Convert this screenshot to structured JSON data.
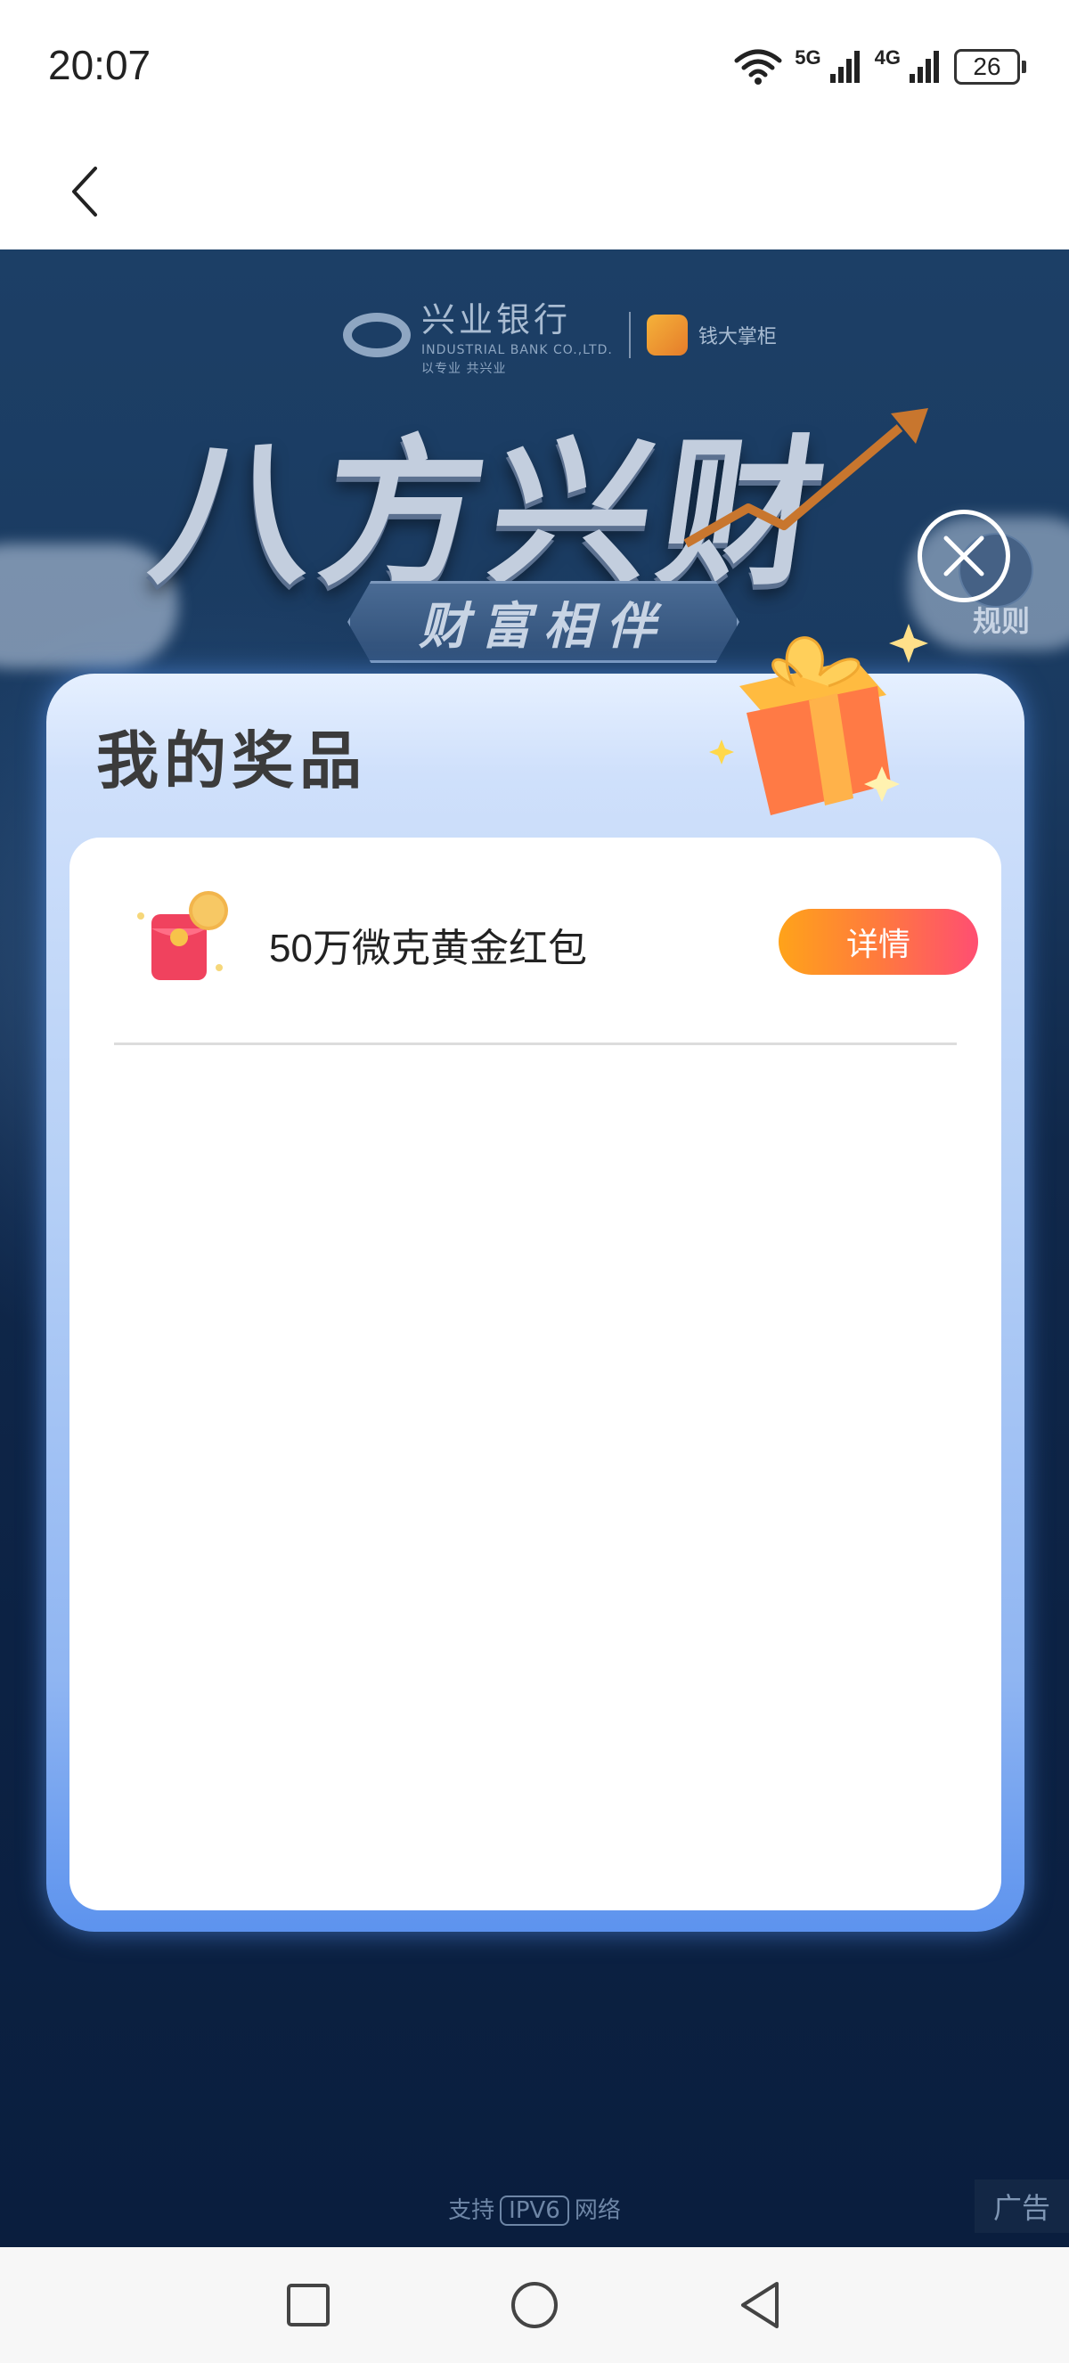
{
  "status_bar": {
    "time": "20:07",
    "network_1": "5G",
    "network_2": "4G",
    "battery": "26"
  },
  "banner": {
    "bank_name": "兴业银行",
    "bank_english": "INDUSTRIAL BANK CO.,LTD.",
    "bank_slogan": "以专业 共兴业",
    "partner_name": "钱大掌柜",
    "title": "八方兴财",
    "subtitle": "财富相伴",
    "rules_label": "规则"
  },
  "modal": {
    "title": "我的奖品",
    "prizes": [
      {
        "icon_tag": "黄金红包",
        "name": "50万微克黄金红包",
        "button_label": "详情"
      }
    ]
  },
  "footer": {
    "support_prefix": "支持",
    "ipv6": "IPV6",
    "support_suffix": "网络",
    "ad_label": "广告"
  },
  "colors": {
    "detail_button_start": "#ffa31a",
    "detail_button_end": "#ff4e72",
    "modal_accent": "#5d93ee"
  },
  "icons": [
    "back-arrow-icon",
    "wifi-icon",
    "signal-icon",
    "battery-icon",
    "close-icon",
    "gift-icon",
    "red-envelope-icon",
    "square-nav-icon",
    "circle-nav-icon",
    "triangle-back-nav-icon"
  ]
}
